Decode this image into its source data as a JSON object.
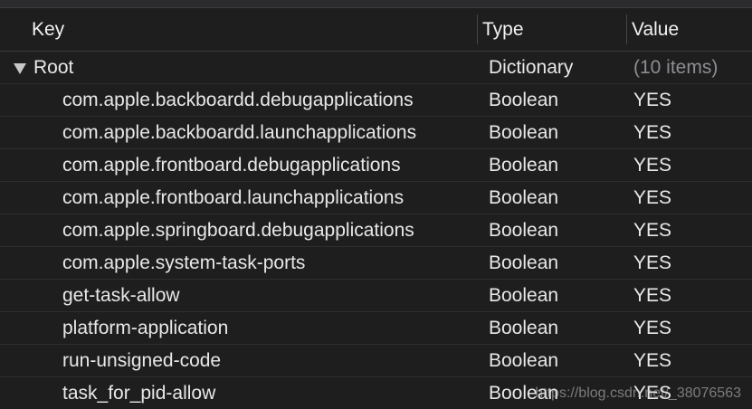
{
  "columns": {
    "key": "Key",
    "type": "Type",
    "value": "Value"
  },
  "root": {
    "key": "Root",
    "type": "Dictionary",
    "value": "(10 items)"
  },
  "items": [
    {
      "key": "com.apple.backboardd.debugapplications",
      "type": "Boolean",
      "value": "YES"
    },
    {
      "key": "com.apple.backboardd.launchapplications",
      "type": "Boolean",
      "value": "YES"
    },
    {
      "key": "com.apple.frontboard.debugapplications",
      "type": "Boolean",
      "value": "YES"
    },
    {
      "key": "com.apple.frontboard.launchapplications",
      "type": "Boolean",
      "value": "YES"
    },
    {
      "key": "com.apple.springboard.debugapplications",
      "type": "Boolean",
      "value": "YES"
    },
    {
      "key": "com.apple.system-task-ports",
      "type": "Boolean",
      "value": "YES"
    },
    {
      "key": "get-task-allow",
      "type": "Boolean",
      "value": "YES"
    },
    {
      "key": "platform-application",
      "type": "Boolean",
      "value": "YES"
    },
    {
      "key": "run-unsigned-code",
      "type": "Boolean",
      "value": "YES"
    },
    {
      "key": "task_for_pid-allow",
      "type": "Boolean",
      "value": "YES"
    }
  ],
  "watermark": "https://blog.csdn.net/_38076563"
}
